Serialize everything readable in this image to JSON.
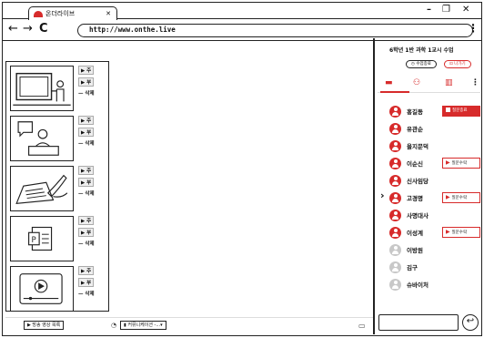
{
  "browser": {
    "tab_title": "온더라이브",
    "minimize": "–",
    "restore": "❐",
    "close": "✕",
    "back": "←",
    "forward": "→",
    "reload": "C",
    "url": "http://www.onthe.live",
    "menu": "⋮"
  },
  "slides": [
    {
      "icon": "whiteboard-teacher-icon",
      "main": "주",
      "sub": "부",
      "delete": "— 삭제"
    },
    {
      "icon": "teacher-desk-icon",
      "main": "주",
      "sub": "부",
      "delete": "— 삭제"
    },
    {
      "icon": "writing-hand-icon",
      "main": "주",
      "sub": "부",
      "delete": "— 삭제"
    },
    {
      "icon": "powerpoint-icon",
      "main": "주",
      "sub": "부",
      "delete": "— 삭제"
    },
    {
      "icon": "video-player-icon",
      "main": "주",
      "sub": "부",
      "delete": "— 삭제"
    }
  ],
  "bottombar": {
    "video_list": "▶ 방송 영상 목록",
    "communication": "▮ 커뮤니케이션 -...▾"
  },
  "sidebar": {
    "title": "6학년 1반 과학 1교시 수업",
    "end_class": "◷ 수업종료",
    "leave": "⊡ 나가기",
    "expand": "›",
    "tabs": [
      {
        "name": "chat-tab",
        "glyph": "▬"
      },
      {
        "name": "participants-tab",
        "glyph": "⚇"
      },
      {
        "name": "board-tab",
        "glyph": "▥"
      },
      {
        "name": "more-tab",
        "glyph": "⋮"
      }
    ],
    "users": [
      {
        "name": "홍길동",
        "active": true,
        "action": "stop",
        "action_label": "질문종료"
      },
      {
        "name": "유관순",
        "active": true,
        "action": "",
        "action_label": ""
      },
      {
        "name": "을지문덕",
        "active": true,
        "action": "",
        "action_label": ""
      },
      {
        "name": "이순신",
        "active": true,
        "action": "accept",
        "action_label": "질문수락"
      },
      {
        "name": "신사임당",
        "active": true,
        "action": "",
        "action_label": ""
      },
      {
        "name": "고경명",
        "active": true,
        "action": "accept",
        "action_label": "질문수락"
      },
      {
        "name": "사명대사",
        "active": true,
        "action": "",
        "action_label": ""
      },
      {
        "name": "이성계",
        "active": true,
        "action": "accept",
        "action_label": "질문수락"
      },
      {
        "name": "이방원",
        "active": false,
        "action": "",
        "action_label": ""
      },
      {
        "name": "김구",
        "active": false,
        "action": "",
        "action_label": ""
      },
      {
        "name": "슈바이처",
        "active": false,
        "action": "",
        "action_label": ""
      }
    ],
    "send": "↩"
  }
}
